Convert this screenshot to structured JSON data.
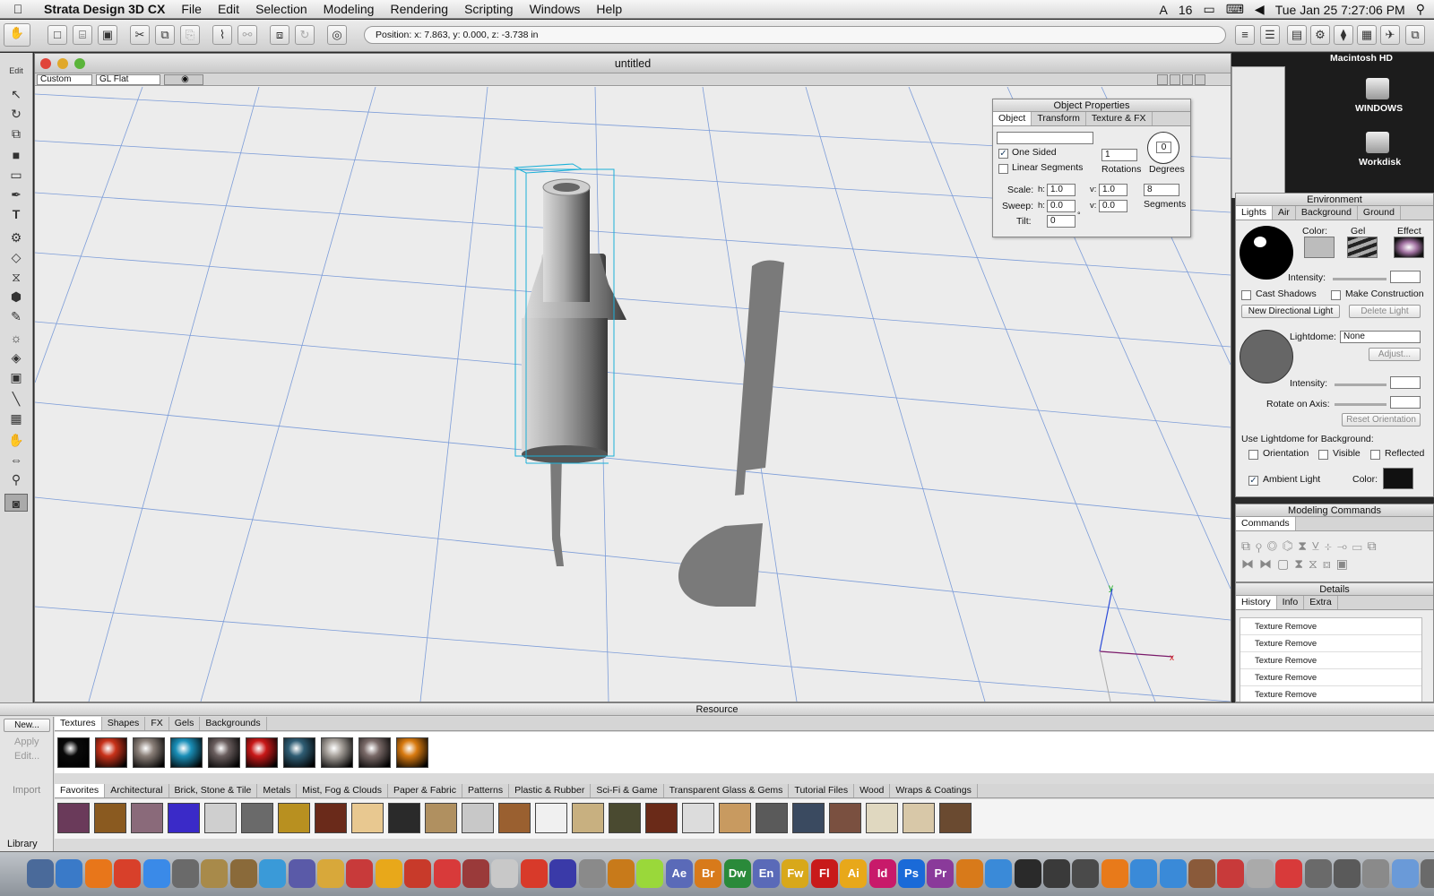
{
  "menubar": {
    "apple": "",
    "app_name": "Strata Design 3D CX",
    "items": [
      "File",
      "Edit",
      "Selection",
      "Modeling",
      "Rendering",
      "Scripting",
      "Windows",
      "Help"
    ],
    "status_count": "16",
    "clock": "Tue Jan 25  7:27:06 PM"
  },
  "toolbar": {
    "position_text": "Position:  x: 7.863,  y: 0.000,  z: -3.738 in"
  },
  "left_tools": {
    "edit_label": "Edit"
  },
  "document": {
    "title": "untitled",
    "view_preset": "Custom",
    "render_mode": "GL Flat"
  },
  "object_properties": {
    "title": "Object Properties",
    "tabs": [
      "Object",
      "Transform",
      "Texture & FX"
    ],
    "name_value": "",
    "one_sided_label": "One Sided",
    "one_sided_checked": true,
    "linear_segments_label": "Linear Segments",
    "linear_segments_checked": false,
    "rotations_value": "1",
    "rotations_label": "Rotations",
    "degrees_value": "0",
    "degrees_label": "Degrees",
    "scale_label": "Scale:",
    "scale_h": "1.0",
    "scale_v": "1.0",
    "sweep_label": "Sweep:",
    "sweep_h": "0.0",
    "sweep_v": "0.0",
    "tilt_label": "Tilt:",
    "tilt_value": "0",
    "segments_value": "8",
    "segments_label": "Segments",
    "h_label": "h:",
    "v_label": "v:",
    "degree_sign": "°"
  },
  "desktop": {
    "volume_top": "Macintosh HD",
    "volume1": "WINDOWS",
    "volume2": "Workdisk"
  },
  "environment": {
    "title": "Environment",
    "tabs": [
      "Lights",
      "Air",
      "Background",
      "Ground"
    ],
    "color_label": "Color:",
    "gel_label": "Gel",
    "effect_label": "Effect",
    "intensity_label": "Intensity:",
    "cast_shadows_label": "Cast Shadows",
    "make_construction_label": "Make Construction",
    "new_light_button": "New Directional Light",
    "delete_light_button": "Delete Light",
    "lightdome_label": "Lightdome:",
    "lightdome_value": "None",
    "adjust_button": "Adjust...",
    "intensity2_label": "Intensity:",
    "rotate_axis_label": "Rotate on Axis:",
    "reset_orientation_button": "Reset Orientation",
    "use_lightdome_label": "Use Lightdome for Background:",
    "orientation_label": "Orientation",
    "visible_label": "Visible",
    "reflected_label": "Reflected",
    "ambient_label": "Ambient Light",
    "ambient_checked": true,
    "ambient_color_label": "Color:",
    "ambient_color": "#111111"
  },
  "modeling_commands": {
    "title": "Modeling Commands",
    "tab": "Commands"
  },
  "details": {
    "title": "Details",
    "tabs": [
      "History",
      "Info",
      "Extra"
    ],
    "history": [
      "Texture Remove",
      "Texture Remove",
      "Texture Remove",
      "Texture Remove",
      "Texture Remove"
    ]
  },
  "resource": {
    "title": "Resource",
    "new_button": "New...",
    "apply_button": "Apply",
    "edit_button": "Edit...",
    "import_button": "Import",
    "library_label": "Library",
    "type_tabs": [
      "Textures",
      "Shapes",
      "FX",
      "Gels",
      "Backgrounds"
    ],
    "library_tabs": [
      "Favorites",
      "Architectural",
      "Brick, Stone & Tile",
      "Metals",
      "Mist, Fog & Clouds",
      "Paper & Fabric",
      "Patterns",
      "Plastic & Rubber",
      "Sci-Fi & Game",
      "Transparent Glass & Gems",
      "Tutorial Files",
      "Wood",
      "Wraps & Coatings"
    ],
    "top_swatch_colors": [
      "#0a0a0a",
      "#c8321a",
      "#8a7f78",
      "#1a8fb8",
      "#6a5e5e",
      "#c81818",
      "#2f5d74",
      "#a8a29c",
      "#7a6a68",
      "#d87a10"
    ],
    "bottom_swatch_colors": [
      "#6a3a5a",
      "#8a5a20",
      "#8a6a7a",
      "#3a2ac8",
      "#cfcfcf",
      "#6a6a6a",
      "#b89020",
      "#6a2a1a",
      "#e8c890",
      "#2a2a2a",
      "#b09060",
      "#c8c8c8",
      "#9a6030",
      "#f0f0f0",
      "#c8b080",
      "#4a4a30",
      "#6a2a18",
      "#dcdcdc",
      "#c89a60",
      "#5a5a5a",
      "#3a4a60",
      "#7a5040",
      "#e0d8c0",
      "#d8c8a8",
      "#6a4a30"
    ]
  },
  "dock": {
    "apps": [
      "",
      "",
      "",
      "",
      "",
      "",
      "",
      "",
      "",
      "",
      "",
      "",
      "",
      "",
      "",
      "",
      "",
      "",
      "",
      "",
      "",
      "",
      "Ae",
      "Br",
      "Dw",
      "En",
      "Fw",
      "Fl",
      "Ai",
      "Id",
      "Ps",
      "Pr",
      "",
      "",
      "",
      "",
      "",
      "",
      "",
      "",
      "",
      "",
      "",
      "",
      "",
      "",
      "",
      "",
      ""
    ]
  }
}
